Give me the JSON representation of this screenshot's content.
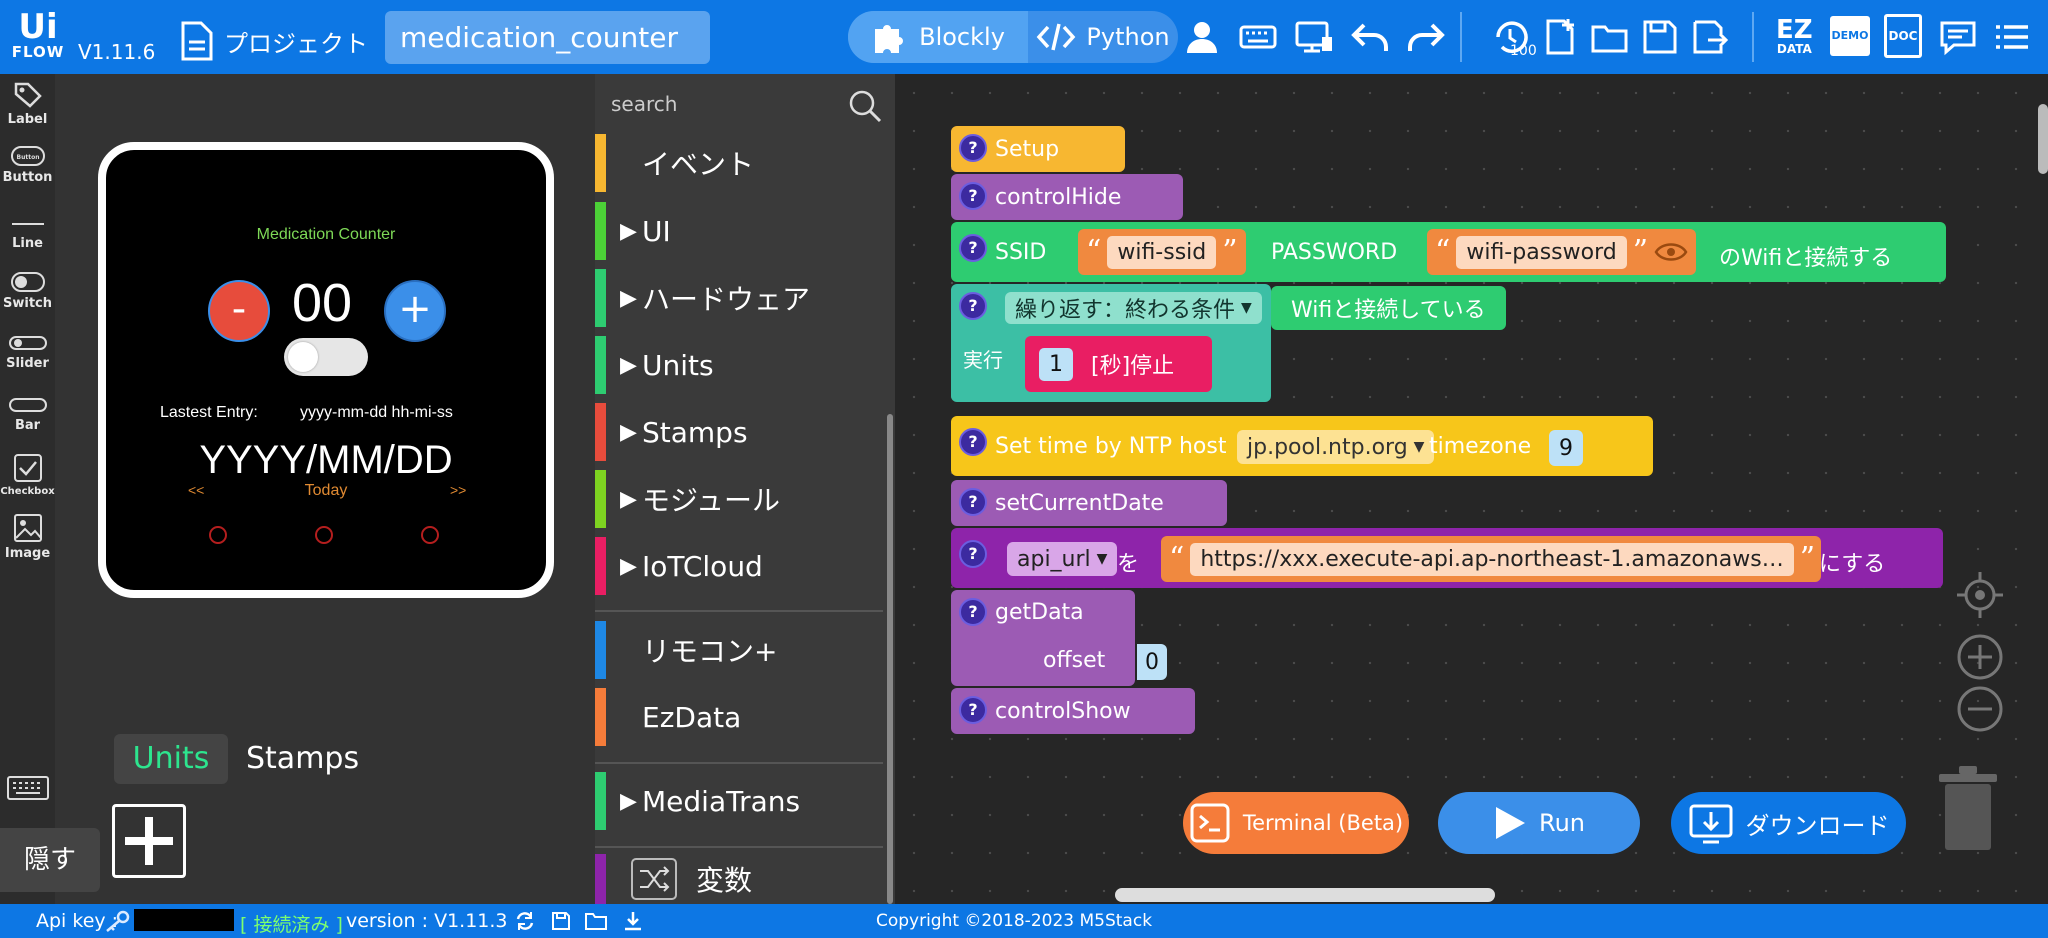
{
  "app": {
    "logo_top": "Ui",
    "logo_bottom": "FLOW",
    "version": "V1.11.6",
    "project_label": "プロジェクト",
    "project_name": "medication_counter"
  },
  "modes": {
    "blockly": "Blockly",
    "python": "Python"
  },
  "palette": [
    {
      "label": "Label",
      "icon": "tag-icon"
    },
    {
      "label": "Button",
      "icon": "button-icon",
      "icon_text": "Button"
    },
    {
      "label": "Line",
      "icon": "line-icon"
    },
    {
      "label": "Switch",
      "icon": "switch-icon"
    },
    {
      "label": "Slider",
      "icon": "slider-icon"
    },
    {
      "label": "Bar",
      "icon": "bar-icon"
    },
    {
      "label": "Checkbox",
      "icon": "checkbox-icon"
    },
    {
      "label": "Image",
      "icon": "image-icon"
    }
  ],
  "device": {
    "title": "Medication Counter",
    "count": "00",
    "minus": "-",
    "plus": "+",
    "latest_label": "Lastest Entry:",
    "latest_value": "yyyy-mm-dd hh-mi-ss",
    "date": "YYYY/MM/DD",
    "prev": "<<",
    "today": "Today",
    "next": ">>"
  },
  "tabs": {
    "units": "Units",
    "stamps": "Stamps",
    "hide": "隠す"
  },
  "search": {
    "placeholder": "search"
  },
  "categories": [
    {
      "label": "イベント",
      "color": "#f7b731",
      "arrow": false
    },
    {
      "label": "UI",
      "color": "#4cd137",
      "arrow": true
    },
    {
      "label": "ハードウェア",
      "color": "#2ecc71",
      "arrow": true
    },
    {
      "label": "Units",
      "color": "#2ecc71",
      "arrow": true
    },
    {
      "label": "Stamps",
      "color": "#e74c3c",
      "arrow": true
    },
    {
      "label": "モジュール",
      "color": "#7ed321",
      "arrow": true
    },
    {
      "label": "IoTCloud",
      "color": "#e91e63",
      "arrow": true
    },
    {
      "label": "リモコン+",
      "color": "#1e88e5",
      "arrow": false
    },
    {
      "label": "EzData",
      "color": "#f57c3a",
      "arrow": false
    },
    {
      "label": "MediaTrans",
      "color": "#2ecc71",
      "arrow": true
    },
    {
      "label": "変数",
      "color": "#8e24aa",
      "arrow": false
    }
  ],
  "blocks": {
    "setup": "Setup",
    "control_hide": "controlHide",
    "ssid_label": "SSID",
    "ssid_value": "wifi-ssid",
    "password_label": "PASSWORD",
    "password_value": "wifi-password",
    "wifi_connect": "のWifiと接続する",
    "repeat": "繰り返す：終わる条件",
    "wifi_connected": "Wifiと接続している",
    "do_label": "実行",
    "sleep_value": "1",
    "sleep_label": "[秒]停止",
    "ntp_label": "Set time by NTP host",
    "ntp_host": "jp.pool.ntp.org",
    "timezone_label": "timezone",
    "timezone_value": "9",
    "set_current_date": "setCurrentDate",
    "var_name": "api_url",
    "wo": "を",
    "api_url_value": "https://xxx.execute-api.ap-northeast-1.amazonaws…",
    "suru": "にする",
    "get_data": "getData",
    "offset_label": "offset",
    "offset_value": "0",
    "control_show": "controlShow"
  },
  "buttons": {
    "terminal": "Terminal (Beta)",
    "run": "Run",
    "download": "ダウンロード"
  },
  "status": {
    "api_key_label": "Api key :",
    "connected": "[ 接続済み ]",
    "version": "version : V1.11.3",
    "copyright": "Copyright ©2018-2023 M5Stack"
  },
  "toolbar_icons": {
    "history_count": "100",
    "ez_top": "EZ",
    "ez_bottom": "DATA",
    "demo": "DEMO",
    "doc": "DOC"
  },
  "colors": {
    "primary": "#0d77e4",
    "event": "#f7b731",
    "wifi": "#2ecc71",
    "loop": "#3cbfa5",
    "sleep": "#e91e63",
    "variable": "#8e24aa",
    "function": "#9c5bb4",
    "string": "#f0893f",
    "terminal": "#f57c3a",
    "run": "#3b8fe9"
  }
}
